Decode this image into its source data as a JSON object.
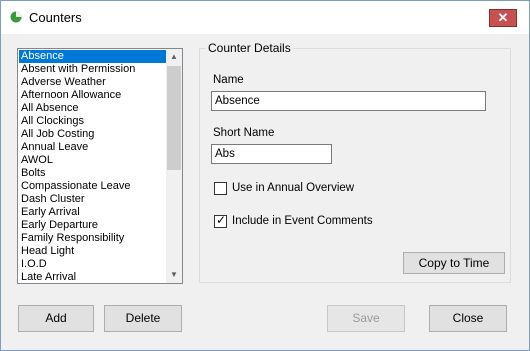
{
  "window": {
    "title": "Counters",
    "close_label": "✕"
  },
  "list": {
    "items": [
      "Absence",
      "Absent with Permission",
      "Adverse Weather",
      "Afternoon Allowance",
      "All Absence",
      "All Clockings",
      "All Job Costing",
      "Annual Leave",
      "AWOL",
      "Bolts",
      "Compassionate Leave",
      "Dash Cluster",
      "Early Arrival",
      "Early Departure",
      "Family Responsibility",
      "Head Light",
      "I.O.D",
      "Late Arrival"
    ],
    "selected": "Absence"
  },
  "details": {
    "legend": "Counter Details",
    "name_label": "Name",
    "name_value": "Absence",
    "short_name_label": "Short Name",
    "short_name_value": "Abs",
    "annual_overview_label": "Use in Annual Overview",
    "annual_overview_checked": false,
    "event_comments_label": "Include in Event Comments",
    "event_comments_checked": true,
    "copy_button": "Copy to Time"
  },
  "buttons": {
    "add": "Add",
    "delete": "Delete",
    "save": "Save",
    "close": "Close"
  }
}
